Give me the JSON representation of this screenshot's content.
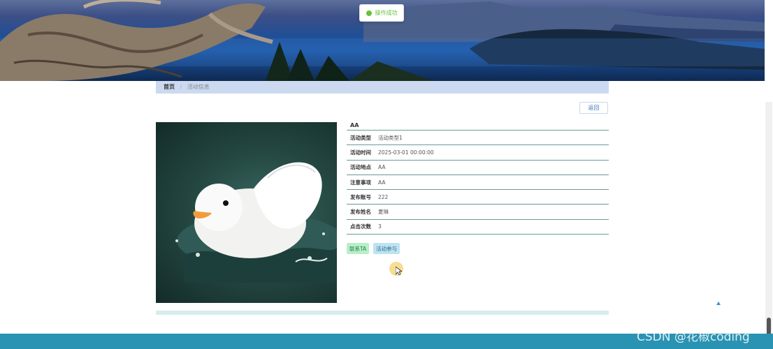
{
  "toast": {
    "message": "操作成功",
    "icon": "check-circle-icon",
    "color": "#67c23a"
  },
  "breadcrumb": {
    "home": "首页",
    "separator": "/",
    "current": "活动信息"
  },
  "back_button": {
    "label": "返回"
  },
  "activity": {
    "title": "AA",
    "fields": [
      {
        "label": "活动类型",
        "value": "活动类型1"
      },
      {
        "label": "活动时间",
        "value": "2025-03-01 00:00:00"
      },
      {
        "label": "活动地点",
        "value": "AA"
      },
      {
        "label": "注意事项",
        "value": "AA"
      },
      {
        "label": "发布账号",
        "value": "222"
      },
      {
        "label": "发布姓名",
        "value": "夏琳"
      },
      {
        "label": "点击次数",
        "value": "3"
      }
    ]
  },
  "actions": {
    "contact": "联系TA",
    "join": "活动参与"
  },
  "watermark": "CSDN @花椒coding",
  "colors": {
    "footer": "#2a93b3",
    "breadcrumb_bg": "#cbdaf0",
    "divider": "#6a9a98"
  }
}
